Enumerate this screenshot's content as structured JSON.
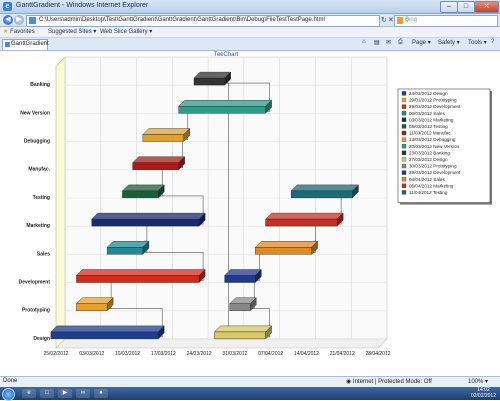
{
  "window": {
    "title": "GanttGradient - Windows Internet Explorer"
  },
  "address": {
    "url": "C:\\Users\\admin\\Desktop\\Test\\GanttGradient\\GanttGradient\\GanttGradient\\Bin\\Debug\\FileTestTestPage.html"
  },
  "search": {
    "placeholder": "Bing"
  },
  "favorites": {
    "label": "Favorites",
    "suggested": "Suggested Sites ▾",
    "gallery": "Web Slice Gallery ▾"
  },
  "tab": {
    "label": "GanttGradient"
  },
  "commands": {
    "page": "Page ▾",
    "safety": "Safety ▾",
    "tools": "Tools ▾"
  },
  "status": {
    "left": "Done",
    "zone": "Internet | Protected Mode: Off",
    "zoom": "100% ▾"
  },
  "clock": {
    "time": "14:02",
    "date": "02/02/2012"
  },
  "chart_data": {
    "type": "gantt",
    "title": "TeeChart",
    "categories": [
      "Design",
      "Prototyping",
      "Development",
      "Sales",
      "Marketing",
      "Testing",
      "Manufac.",
      "Debugging",
      "New Version",
      "Banking"
    ],
    "x_ticks": [
      "25/02/2012",
      "03/03/2012",
      "10/03/2012",
      "17/03/2012",
      "24/03/2012",
      "31/03/2012",
      "07/04/2012",
      "14/04/2012",
      "21/04/2012",
      "28/04/2012"
    ],
    "xlim": [
      "25/02/2012",
      "28/04/2012"
    ],
    "tasks": [
      {
        "category": "Design",
        "start": "24/02/2012",
        "end": "16/03/2012",
        "color": "#1d3f8f"
      },
      {
        "category": "Prototyping",
        "start": "29/02/2012",
        "end": "06/03/2012",
        "color": "#e8a030"
      },
      {
        "category": "Development",
        "start": "29/02/2012",
        "end": "24/03/2012",
        "color": "#d22b1c"
      },
      {
        "category": "Sales",
        "start": "06/03/2012",
        "end": "13/03/2012",
        "color": "#1e8a96"
      },
      {
        "category": "Marketing",
        "start": "03/03/2012",
        "end": "24/03/2012",
        "color": "#1a2a6e"
      },
      {
        "category": "Testing",
        "start": "09/03/2012",
        "end": "16/03/2012",
        "color": "#1b5e3a"
      },
      {
        "category": "Manufac.",
        "start": "11/03/2012",
        "end": "20/03/2012",
        "color": "#b01818"
      },
      {
        "category": "Debugging",
        "start": "13/03/2012",
        "end": "21/03/2012",
        "color": "#e0a030"
      },
      {
        "category": "New Version",
        "start": "20/03/2012",
        "end": "06/04/2012",
        "color": "#2a9e8a"
      },
      {
        "category": "Banking",
        "start": "23/03/2012",
        "end": "29/03/2012",
        "color": "#333333"
      },
      {
        "category": "Design",
        "start": "27/03/2012",
        "end": "06/04/2012",
        "color": "#d8c868"
      },
      {
        "category": "Prototyping",
        "start": "30/03/2012",
        "end": "03/04/2012",
        "color": "#888888"
      },
      {
        "category": "Development",
        "start": "29/03/2012",
        "end": "04/04/2012",
        "color": "#1e3a8a"
      },
      {
        "category": "Sales",
        "start": "04/04/2012",
        "end": "15/04/2012",
        "color": "#e08a20"
      },
      {
        "category": "Marketing",
        "start": "06/04/2012",
        "end": "20/04/2012",
        "color": "#c83020"
      },
      {
        "category": "Testing",
        "start": "11/04/2012",
        "end": "23/04/2012",
        "color": "#1a6a7a"
      }
    ],
    "legend": [
      {
        "label": "24/02/2012 Design",
        "color": "#1d3f8f"
      },
      {
        "label": "29/02/2012 Prototyping",
        "color": "#e8a030"
      },
      {
        "label": "29/02/2012 Development",
        "color": "#d22b1c"
      },
      {
        "label": "06/03/2012 Sales",
        "color": "#1e8a96"
      },
      {
        "label": "03/03/2012 Marketing",
        "color": "#1a2a6e"
      },
      {
        "label": "09/03/2012 Testing",
        "color": "#1b5e3a"
      },
      {
        "label": "11/03/2012 Manufac.",
        "color": "#b01818"
      },
      {
        "label": "13/03/2012 Debugging",
        "color": "#e0a030"
      },
      {
        "label": "20/03/2012 New Version",
        "color": "#2a9e8a"
      },
      {
        "label": "23/03/2012 Banking",
        "color": "#333333"
      },
      {
        "label": "27/03/2012 Design",
        "color": "#d8c868"
      },
      {
        "label": "30/03/2012 Prototyping",
        "color": "#888888"
      },
      {
        "label": "29/03/2012 Development",
        "color": "#1e3a8a"
      },
      {
        "label": "04/04/2012 Sales",
        "color": "#e08a20"
      },
      {
        "label": "06/04/2012 Marketing",
        "color": "#c83020"
      },
      {
        "label": "11/04/2012 Testing",
        "color": "#1a6a7a"
      }
    ],
    "legend_position": "right",
    "grid": true
  }
}
